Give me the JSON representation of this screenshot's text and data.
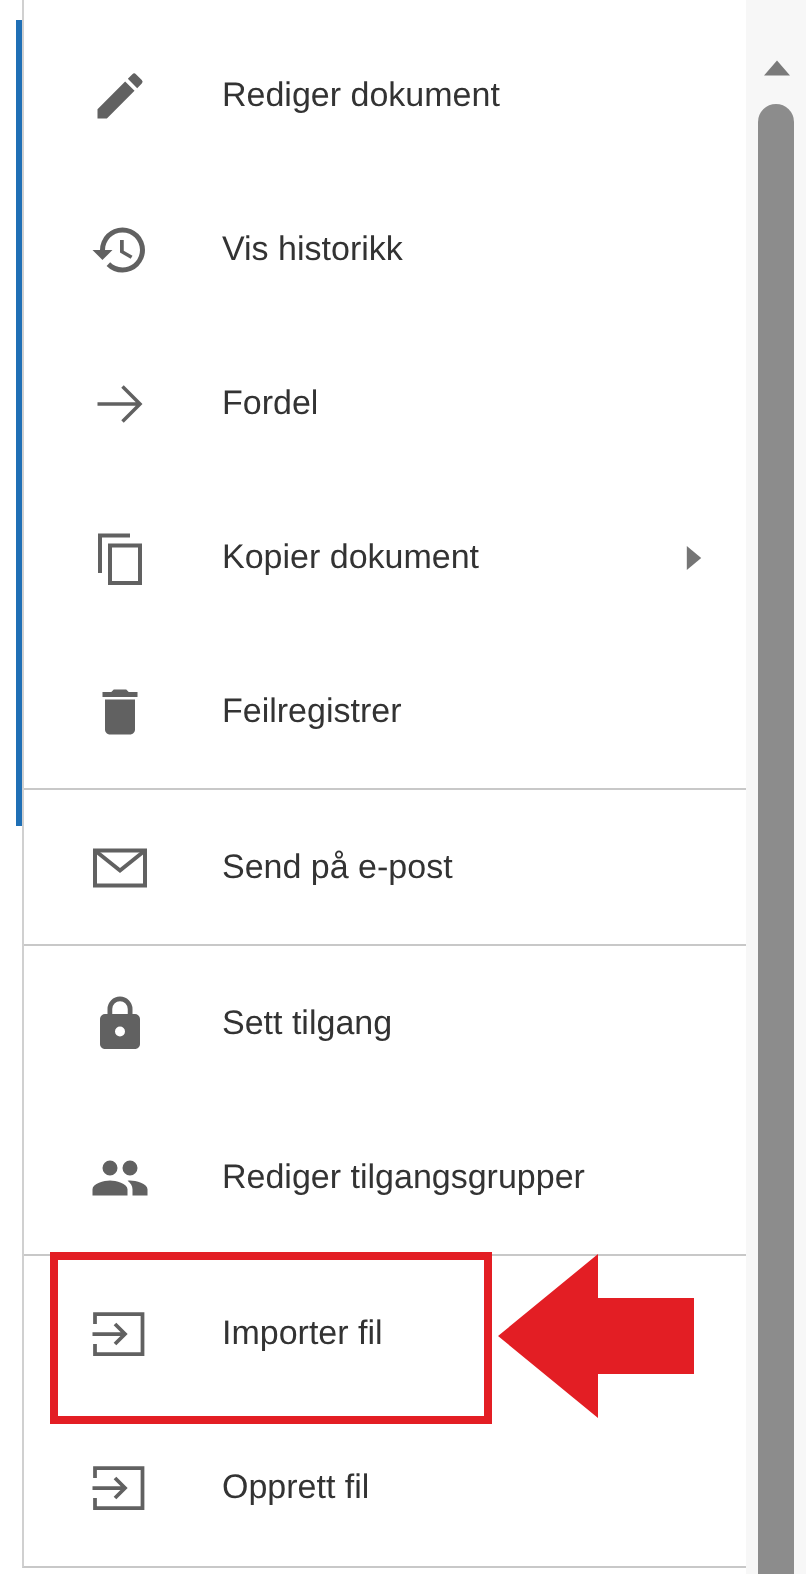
{
  "menu": {
    "groups": [
      {
        "items": [
          {
            "kind": "pencil",
            "label": "Rediger dokument",
            "submenu": false,
            "highlighted": false
          },
          {
            "kind": "history",
            "label": "Vis historikk",
            "submenu": false,
            "highlighted": false
          },
          {
            "kind": "arrow",
            "label": "Fordel",
            "submenu": false,
            "highlighted": false
          },
          {
            "kind": "copy",
            "label": "Kopier dokument",
            "submenu": true,
            "highlighted": false
          },
          {
            "kind": "trash",
            "label": "Feilregistrer",
            "submenu": false,
            "highlighted": false
          }
        ]
      },
      {
        "items": [
          {
            "kind": "mail",
            "label": "Send på e-post",
            "submenu": false,
            "highlighted": false
          }
        ]
      },
      {
        "items": [
          {
            "kind": "lock",
            "label": "Sett tilgang",
            "submenu": false,
            "highlighted": false
          },
          {
            "kind": "people",
            "label": "Rediger tilgangsgrupper",
            "submenu": false,
            "highlighted": false
          }
        ]
      },
      {
        "items": [
          {
            "kind": "import",
            "label": "Importer fil",
            "submenu": false,
            "highlighted": true
          },
          {
            "kind": "import",
            "label": "Opprett fil",
            "submenu": false,
            "highlighted": false
          }
        ]
      }
    ]
  }
}
